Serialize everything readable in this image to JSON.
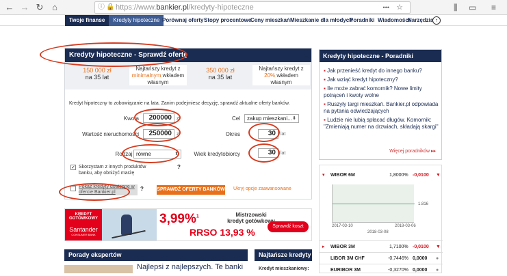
{
  "browser": {
    "url_host": "https://www.",
    "url_domain": "bankier.pl",
    "url_path": "/kredyty-hipoteczne",
    "menu_dots": "•••"
  },
  "site_nav": {
    "tabs": [
      "Twoje finanse",
      "Kredyty hipoteczne"
    ],
    "links": [
      "Porównaj oferty",
      "Stopy procentowe",
      "Ceny mieszkań",
      "Mieszkanie dla młodych",
      "Poradniki",
      "Wiadomości",
      "Narzędzia"
    ]
  },
  "calculator": {
    "title": "Kredyty hipoteczne - Sprawdź ofertę",
    "promos": [
      {
        "amount": "150 000 zł",
        "years": "na 35 lat"
      },
      {
        "line1": "Najtańszy kredyt z",
        "highlight": "minimalnym",
        "line2": "wkładem",
        "line3": "własnym"
      },
      {
        "amount": "350 000 zł",
        "years": "na 35 lat"
      },
      {
        "line1": "Najtańszy kredyt z",
        "highlight": "20%",
        "line2": "wkładem",
        "line3": "własnym"
      }
    ],
    "intro": "Kredyt hipoteczny to zobowiązanie na lata. Zanim podejmiesz decyzję, sprawdź aktualne oferty banków.",
    "kwota_label": "Kwota",
    "kwota_value": "200000",
    "currency": "zł",
    "cel_label": "Cel",
    "cel_value": "zakup mieszkani...",
    "wartosc_label": "Wartość nieruchomości",
    "wartosc_value": "250000",
    "okres_label": "Okres",
    "okres_value": "30",
    "years_unit": "lat",
    "rodzaj_label": "Rodzaj rat",
    "rodzaj_value": "równe",
    "wiek_label": "Wiek kredytobiorcy",
    "wiek_value": "30",
    "check1": "Skorzystam z innych produktów banku, aby obniżyć marżę",
    "help": "?",
    "check2": "Pokaż kredyty dostępne w ofercie Bankier.pl",
    "submit": "SPRAWDŹ OFERTY BANKÓW",
    "advanced": "Ukryj opcje zaawansowane"
  },
  "banner": {
    "label1": "KREDYT",
    "label2": "GOTÓWKOWY",
    "brand": "Santander",
    "brand_sub": "CONSUMER BANK",
    "rate": "3,99%",
    "rate_sup": "1",
    "title1": "Mistrzowski",
    "title2": "kredyt gotówkowy",
    "rrso": "RRSO 13,93 %",
    "cta": "Sprawdź koszt"
  },
  "guides": {
    "title": "Kredyty hipoteczne - Poradniki",
    "items": [
      "Jak przenieść kredyt do innego banku?",
      "Jak wziąć kredyt hipoteczny?",
      "Ile może zabrać komornik? Nowe limity potrąceń i kwoty wolne",
      "Ruszyły targi mieszkań. Bankier.pl odpowiada na pytania odwiedzających",
      "Ludzie nie lubią spłacać długów. Komornik: \"Zmieniają numer na drzwiach, składają skargi\""
    ],
    "more": "Więcej poradników ▸▸"
  },
  "rates": {
    "wibor6m": {
      "name": "WIBOR 6M",
      "value": "1,8000%",
      "change": "-0,0100"
    },
    "chart_value": "1.816",
    "chart_date_left": "2017-03-10",
    "chart_date_right": "2018-03-06",
    "chart_date_center": "2018-03-08",
    "rows": [
      {
        "name": "WIBOR 3M",
        "value": "1,7100%",
        "change": "-0,0100"
      },
      {
        "name": "LIBOR 3M CHF",
        "value": "-0,7446%",
        "change": "0,0000"
      },
      {
        "name": "EURIBOR 3M",
        "value": "-0,3270%",
        "change": "0,0000"
      }
    ]
  },
  "experts": {
    "title": "Porady ekspertów",
    "article": "Najlepsi z najlepszych. Te banki"
  },
  "latest": {
    "title": "Najtańsze kredyty",
    "row1": "Kredyt mieszkaniowy:"
  }
}
